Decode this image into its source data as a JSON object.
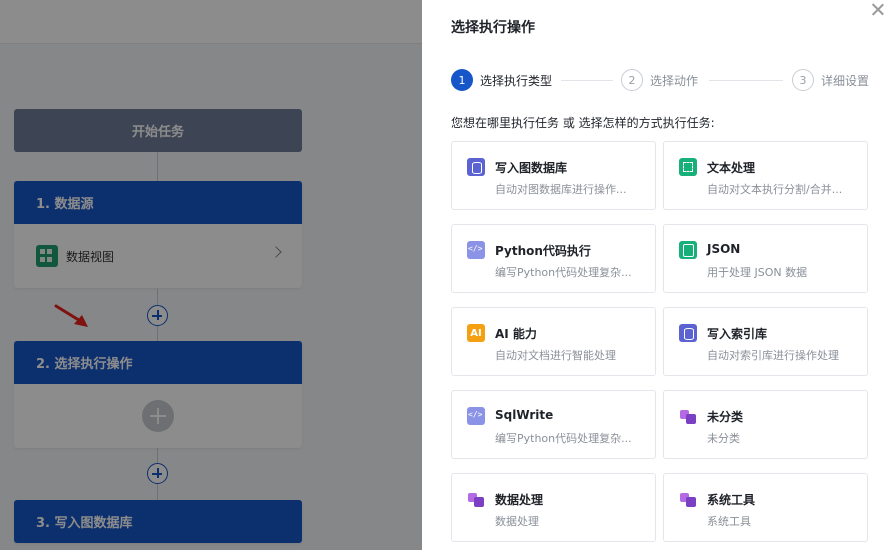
{
  "workflow": {
    "start_label": "开始任务",
    "steps": [
      {
        "label": "1. 数据源",
        "body_label": "数据视图"
      },
      {
        "label": "2. 选择执行操作"
      },
      {
        "label": "3. 写入图数据库"
      }
    ]
  },
  "drawer": {
    "title": "选择执行操作",
    "steps": [
      {
        "num": "1",
        "label": "选择执行类型"
      },
      {
        "num": "2",
        "label": "选择动作"
      },
      {
        "num": "3",
        "label": "详细设置"
      }
    ],
    "question": "您想在哪里执行任务 或 选择怎样的方式执行任务:",
    "cards": [
      {
        "icon": "database-icon",
        "title": "写入图数据库",
        "desc": "自动对图数据库进行操作..."
      },
      {
        "icon": "text-process-icon",
        "title": "文本处理",
        "desc": "自动对文本执行分割/合并..."
      },
      {
        "icon": "code-icon",
        "title": "Python代码执行",
        "desc": "编写Python代码处理复杂..."
      },
      {
        "icon": "json-icon",
        "title": "JSON",
        "desc": "用于处理 JSON 数据"
      },
      {
        "icon": "ai-icon",
        "icon_text": "AI",
        "title": "AI 能力",
        "desc": "自动对文档进行智能处理"
      },
      {
        "icon": "index-database-icon",
        "title": "写入索引库",
        "desc": "自动对索引库进行操作处理"
      },
      {
        "icon": "code-icon",
        "title": "SqlWrite",
        "desc": "编写Python代码处理复杂..."
      },
      {
        "icon": "puzzle-icon",
        "title": "未分类",
        "desc": "未分类"
      },
      {
        "icon": "puzzle-icon",
        "title": "数据处理",
        "desc": "数据处理"
      },
      {
        "icon": "puzzle-icon",
        "title": "系统工具",
        "desc": "系统工具"
      }
    ]
  },
  "colors": {
    "primary": "#1656c9",
    "start_node": "#6f7e99",
    "datasource_icon": "#1f9e6f",
    "ai_icon": "#f5a012",
    "annotation_arrow": "#e8211d"
  }
}
